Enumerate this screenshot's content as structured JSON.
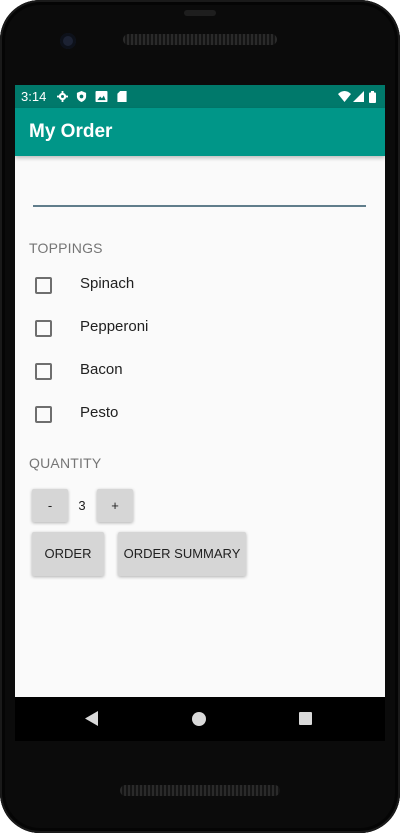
{
  "status_bar": {
    "time": "3:14",
    "icons": [
      "gear-icon",
      "shield-icon",
      "image-icon",
      "sd-card-icon",
      "wifi-icon",
      "signal-icon",
      "battery-icon"
    ]
  },
  "app_bar": {
    "title": "My Order"
  },
  "name_input": {
    "value": "",
    "placeholder": ""
  },
  "toppings": {
    "label": "TOPPINGS",
    "items": [
      {
        "label": "Spinach",
        "checked": false
      },
      {
        "label": "Pepperoni",
        "checked": false
      },
      {
        "label": "Bacon",
        "checked": false
      },
      {
        "label": "Pesto",
        "checked": false
      }
    ]
  },
  "quantity": {
    "label": "QUANTITY",
    "decrement_label": "-",
    "value": "3",
    "increment_label": "+"
  },
  "actions": {
    "order_label": "ORDER",
    "summary_label": "ORDER SUMMARY"
  },
  "nav_bar": {
    "icons": [
      "back-icon",
      "home-icon",
      "recents-icon"
    ]
  },
  "colors": {
    "primary": "#009688",
    "primary_dark": "#00796b",
    "button_bg": "#d6d6d6",
    "input_underline": "#607d8b"
  }
}
